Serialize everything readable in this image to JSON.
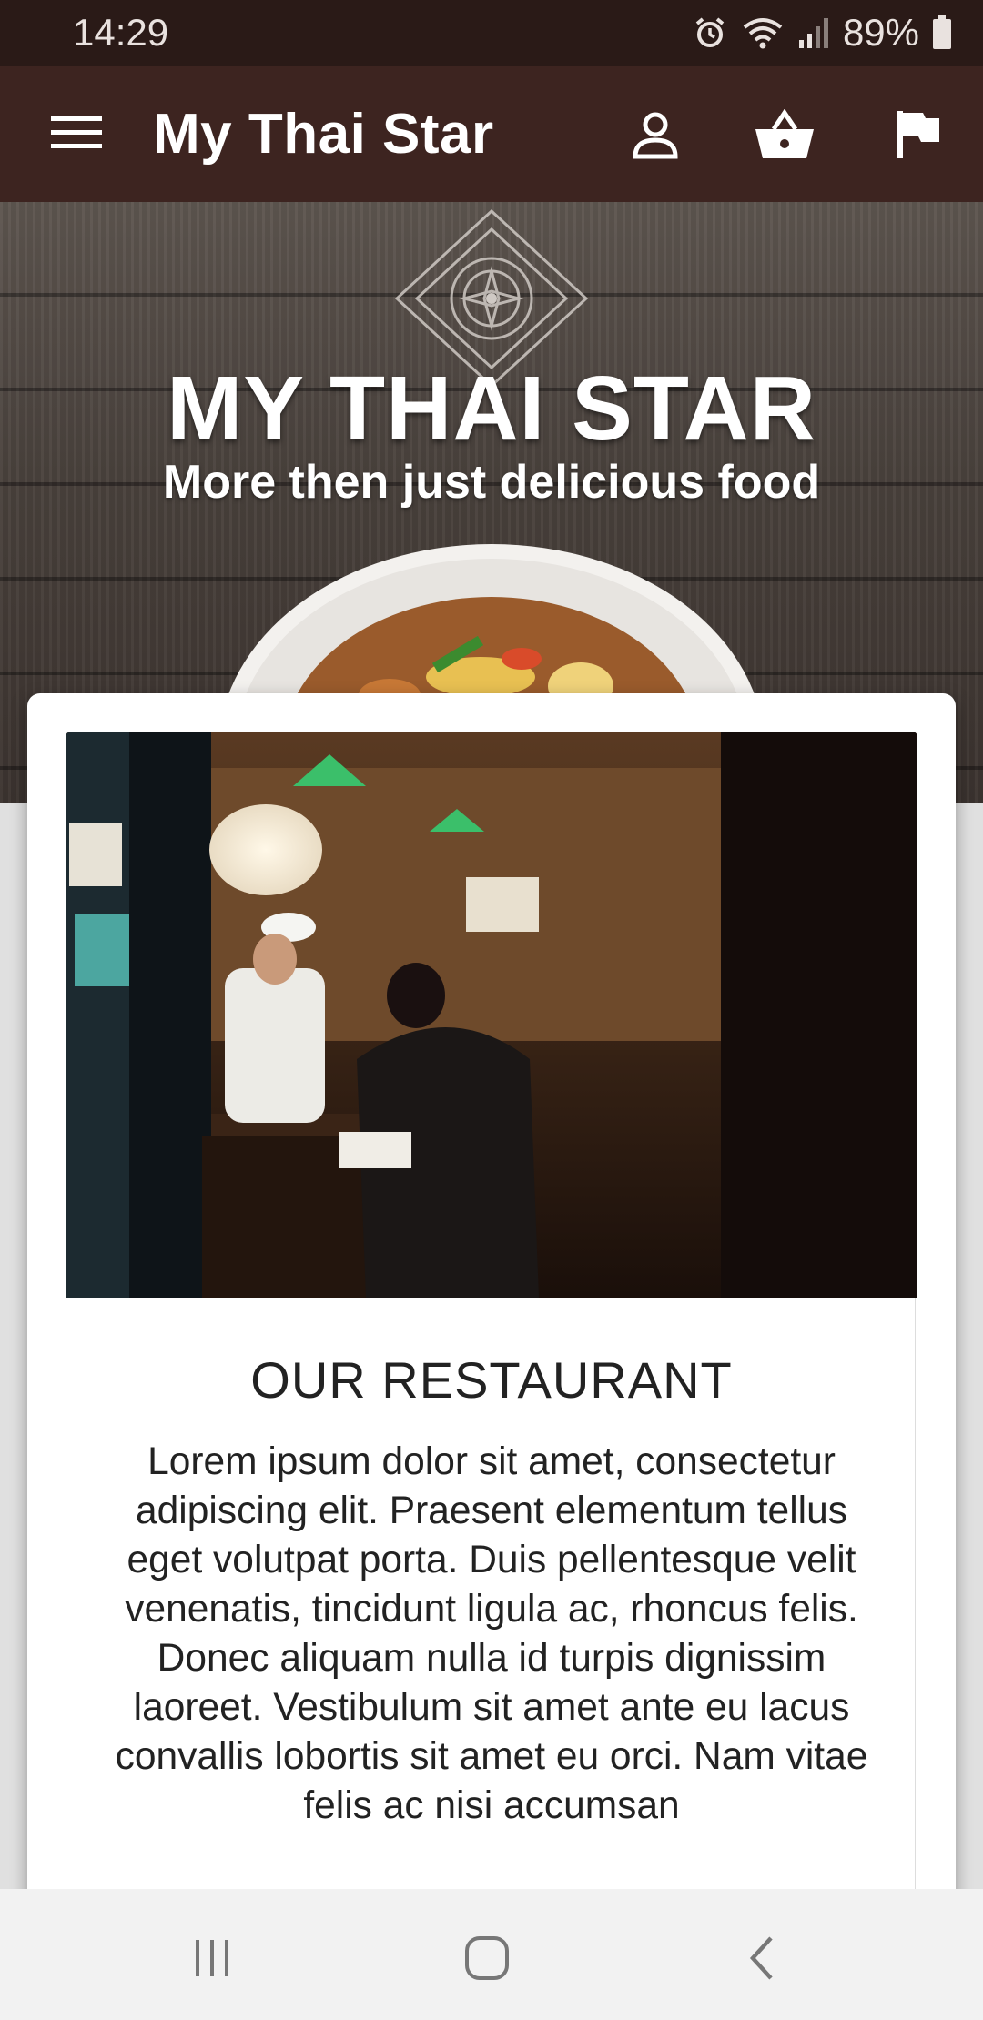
{
  "status_bar": {
    "time": "14:29",
    "battery": "89%",
    "icons": [
      "alarm-icon",
      "wifi-icon",
      "signal-icon",
      "battery-icon"
    ]
  },
  "app_bar": {
    "title": "My Thai Star",
    "icons": [
      "menu-icon",
      "account-icon",
      "basket-icon",
      "flag-icon"
    ],
    "background": "#3d2420"
  },
  "hero": {
    "title": "MY THAI STAR",
    "subtitle": "More then just delicious food"
  },
  "restaurant_card": {
    "title": "OUR RESTAURANT",
    "body": "Lorem ipsum dolor sit amet, consectetur adipiscing elit. Praesent elementum tellus eget volutpat porta. Duis pellentesque velit venenatis, tincidunt ligula ac, rhoncus felis. Donec aliquam nulla id turpis dignissim laoreet. Vestibulum sit amet ante eu lacus convallis lobortis sit amet eu orci. Nam vitae felis ac nisi accumsan"
  },
  "nav_bar": {
    "icons": [
      "recent-apps-icon",
      "home-icon",
      "back-icon"
    ]
  }
}
